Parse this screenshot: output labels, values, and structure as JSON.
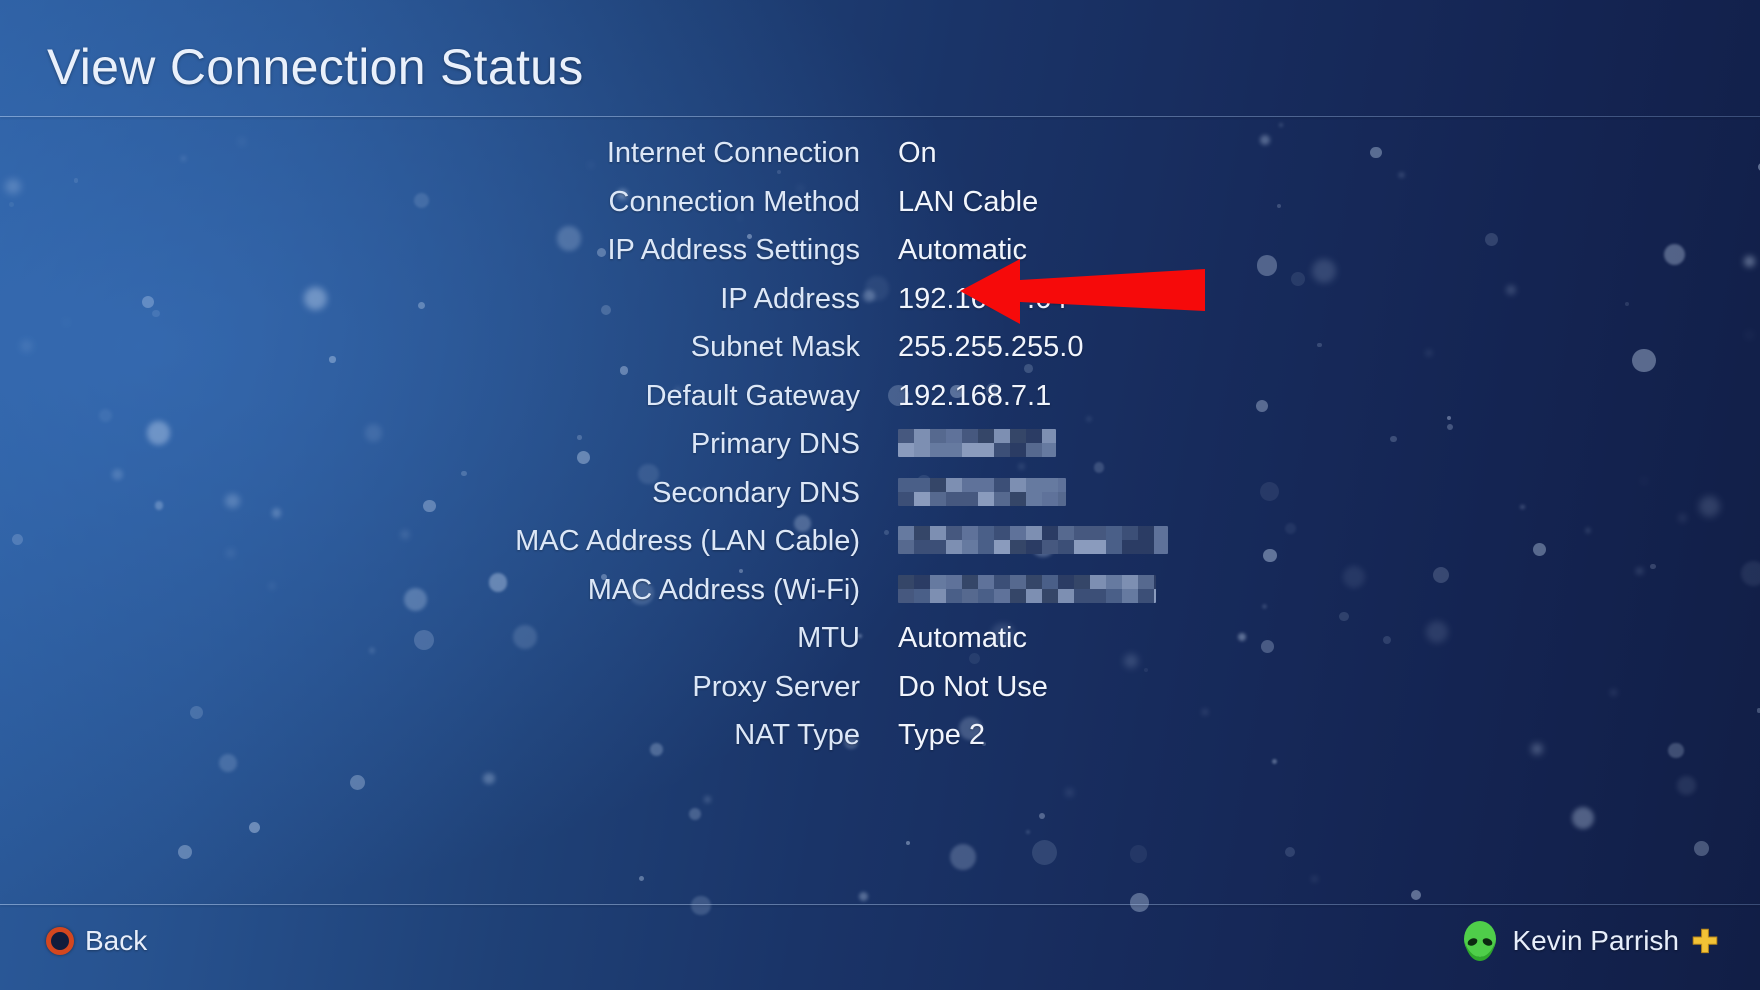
{
  "header": {
    "title": "View Connection Status"
  },
  "connection": {
    "rows": [
      {
        "label": "Internet Connection",
        "value": "On",
        "censored": false
      },
      {
        "label": "Connection Method",
        "value": "LAN Cable",
        "censored": false
      },
      {
        "label": "IP Address Settings",
        "value": "Automatic",
        "censored": false
      },
      {
        "label": "IP Address",
        "value": "192.168.7.64",
        "censored": false
      },
      {
        "label": "Subnet Mask",
        "value": "255.255.255.0",
        "censored": false
      },
      {
        "label": "Default Gateway",
        "value": "192.168.7.1",
        "censored": false
      },
      {
        "label": "Primary DNS",
        "value": "",
        "censored": true,
        "censor_width": 158
      },
      {
        "label": "Secondary DNS",
        "value": "",
        "censored": true,
        "censor_width": 168
      },
      {
        "label": "MAC Address (LAN Cable)",
        "value": "",
        "censored": true,
        "censor_width": 270
      },
      {
        "label": "MAC Address (Wi-Fi)",
        "value": "",
        "censored": true,
        "censor_width": 258
      },
      {
        "label": "MTU",
        "value": "Automatic",
        "censored": false
      },
      {
        "label": "Proxy Server",
        "value": "Do Not Use",
        "censored": false
      },
      {
        "label": "NAT Type",
        "value": "Type 2",
        "censored": false
      }
    ]
  },
  "annotation": {
    "arrow_color": "#f60a0a",
    "points_at": "IP Address"
  },
  "footer": {
    "back_label": "Back",
    "back_icon": "circle-button-icon",
    "user_name": "Kevin Parrish",
    "avatar_icon": "alien-head-avatar",
    "plus_icon": "playstation-plus-icon",
    "plus_color": "#f2c236",
    "circle_color": "#d4471f",
    "avatar_color": "#49c447"
  },
  "theme": {
    "bg_left": "#2c5d9f",
    "bg_right": "#111e46",
    "text_primary": "#f1f5fd",
    "text_label": "#dce7f7"
  }
}
